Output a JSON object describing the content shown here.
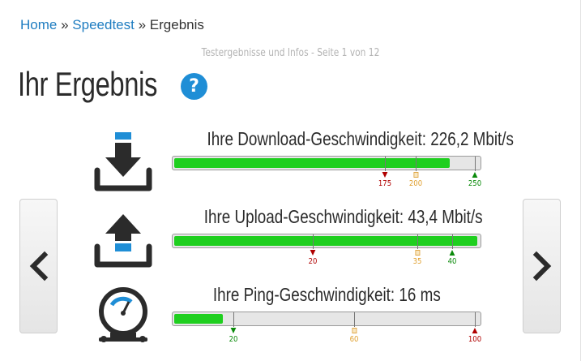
{
  "breadcrumb": {
    "home": "Home",
    "speedtest": "Speedtest",
    "current": "Ergebnis",
    "separator": "»"
  },
  "subtitle": "Testergebnisse und Infos - Seite 1 von 12",
  "page_title": "Ihr Ergebnis",
  "help_icon": {
    "icon": "question-circle-icon",
    "glyph": "?"
  },
  "colors": {
    "accent": "#1f8ed6",
    "bar_fill": "#1fcf1f",
    "bad": "#b00000",
    "medium": "#e0a030",
    "good": "#0a8a0a"
  },
  "metrics": [
    {
      "icon": "download-icon",
      "label": "Ihre Download-Geschwindigkeit: 226,2 Mbit/s",
      "fill_fraction": 0.9,
      "markers": [
        {
          "value": "175",
          "kind": "bad",
          "shape": "triangle-down",
          "fraction": 0.69
        },
        {
          "value": "200",
          "kind": "medium",
          "shape": "square",
          "fraction": 0.79
        },
        {
          "value": "250",
          "kind": "good",
          "shape": "triangle-up",
          "fraction": 0.985
        }
      ]
    },
    {
      "icon": "upload-icon",
      "label": "Ihre Upload-Geschwindigkeit: 43,4 Mbit/s",
      "fill_fraction": 0.99,
      "markers": [
        {
          "value": "20",
          "kind": "bad",
          "shape": "triangle-down",
          "fraction": 0.455
        },
        {
          "value": "35",
          "kind": "medium",
          "shape": "square",
          "fraction": 0.795
        },
        {
          "value": "40",
          "kind": "good",
          "shape": "triangle-up",
          "fraction": 0.91
        }
      ]
    },
    {
      "icon": "ping-gauge-icon",
      "label": "Ihre Ping-Geschwindigkeit: 16 ms",
      "fill_fraction": 0.16,
      "markers": [
        {
          "value": "20",
          "kind": "good",
          "shape": "triangle-down",
          "fraction": 0.195
        },
        {
          "value": "60",
          "kind": "medium",
          "shape": "square",
          "fraction": 0.59
        },
        {
          "value": "100",
          "kind": "bad",
          "shape": "triangle-up",
          "fraction": 0.985
        }
      ]
    }
  ],
  "nav": {
    "prev_icon": "chevron-left-icon",
    "next_icon": "chevron-right-icon"
  }
}
